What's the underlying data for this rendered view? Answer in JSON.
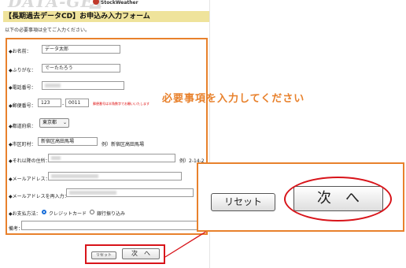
{
  "header": {
    "logo_text": "DATA-GET",
    "logo_num": "2",
    "brand": "StockWeather",
    "form_title": "【長期過去データCD】お申込み入力フォーム",
    "required_note": "以下の必要事項は全てご入力ください。"
  },
  "form": {
    "name_label": "◆お名前：",
    "name_value": "データ太郎",
    "kana_label": "◆ふりがな：",
    "kana_value": "でーたたろう",
    "phone_label": "◆電話番号：",
    "zip_label": "◆郵便番号：",
    "zip1_value": "123",
    "zip_sep": "-",
    "zip2_value": "0011",
    "zip_note": "郵便番号は半角数字でお願いいたします",
    "pref_label": "◆都道府県：",
    "pref_value": "東京都",
    "city_label": "◆市区町村：",
    "city_value": "新宿区高田馬場",
    "city_example": "例）新宿区高田馬場",
    "address_label": "◆それ以降の住所：",
    "address_example": "例）2-14-2",
    "email_label": "◆メールアドレス：",
    "email2_label": "◆メールアドレスを再入力：",
    "payment_label": "◆お支払方法：",
    "pay_card": "クレジットカード",
    "pay_bank": "銀行振り込み",
    "note_label": "備考："
  },
  "buttons": {
    "reset": "リセット",
    "next": "次　へ"
  },
  "annotation": {
    "instruction": "必要事項を入力してください"
  },
  "colors": {
    "accent_orange": "#e8812c",
    "highlight_red": "#d8141a",
    "title_bg": "#efe39b"
  }
}
